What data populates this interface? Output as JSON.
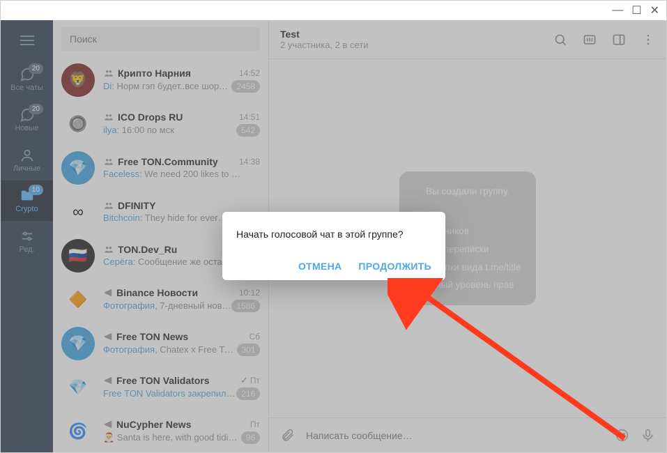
{
  "window": {
    "min": "—",
    "max": "☐",
    "close": "✕"
  },
  "folders": {
    "items": [
      {
        "id": "all",
        "label": "Все чаты",
        "badge": "20"
      },
      {
        "id": "new",
        "label": "Новые",
        "badge": "20"
      },
      {
        "id": "personal",
        "label": "Личные",
        "badge": ""
      },
      {
        "id": "crypto",
        "label": "Crypto",
        "badge": "10",
        "active": true
      },
      {
        "id": "edit",
        "label": "Ред.",
        "badge": ""
      }
    ]
  },
  "search": {
    "placeholder": "Поиск"
  },
  "chats": [
    {
      "icon_bg": "#7a1f1f",
      "emoji": "🦁",
      "type": "group",
      "title": "Крипто Нарния",
      "time": "14:52",
      "sender": "Di",
      "text": " Норм гэп будет..все шорт…",
      "badge": "2458"
    },
    {
      "icon_bg": "#ffffff",
      "emoji": "🔘",
      "type": "group",
      "title": "ICO Drops RU",
      "time": "14:51",
      "sender": "ilya",
      "text": " 16:00 по мск",
      "badge": "542"
    },
    {
      "icon_bg": "#3aa0e0",
      "emoji": "💎",
      "type": "group",
      "title": "Free TON.Community",
      "time": "14:38",
      "sender": "Faceless",
      "text": " We need 200 likes to get top…",
      "badge": ""
    },
    {
      "icon_bg": "#ffffff",
      "emoji": "∞",
      "type": "group",
      "title": "DFINITY",
      "time": "",
      "sender": "Bitchcoin",
      "text": " They hide for ever…",
      "badge": ""
    },
    {
      "icon_bg": "#1a1a1a",
      "emoji": "🇷🇺",
      "type": "group",
      "title": "TON.Dev_Ru",
      "time": "",
      "sender": "Серёга",
      "text": " Сообщение же оста…",
      "badge": ""
    },
    {
      "icon_bg": "#fff",
      "emoji": "🔶",
      "type": "channel",
      "title": "Binance Новости",
      "time": "10:12",
      "media": "Фотография",
      "text": ", 7-дневный нов…",
      "badge": "1586"
    },
    {
      "icon_bg": "#3aa0e0",
      "emoji": "💎",
      "type": "channel",
      "title": "Free TON News",
      "time": "Сб",
      "media": "Фотография",
      "text": ", Chatex x Free TO…",
      "badge": "301"
    },
    {
      "icon_bg": "#fff",
      "emoji": "💎",
      "type": "channel",
      "title": "Free TON Validators",
      "time": "Пт",
      "check": true,
      "link": "Free TON Validators закрепил(…",
      "badge": "216"
    },
    {
      "icon_bg": "#fff",
      "emoji": "🌀",
      "type": "channel",
      "title": "NuCypher News",
      "time": "Пт",
      "pretext": "🎅 ",
      "text": "Santa is here, with good tidin…",
      "badge": "96"
    }
  ],
  "header": {
    "title": "Test",
    "sub": "2 участника, 2 в сети"
  },
  "bubble": {
    "top": "Вы создали группу.",
    "lead": "групп:",
    "items": [
      "участников",
      "ория переписки",
      "е ссылки вида t.me/title",
      "Разный уровень прав"
    ]
  },
  "composer": {
    "placeholder": "Написать сообщение…"
  },
  "modal": {
    "question": "Начать голосовой чат в этой группе?",
    "cancel": "ОТМЕНА",
    "ok": "ПРОДОЛЖИТЬ"
  }
}
